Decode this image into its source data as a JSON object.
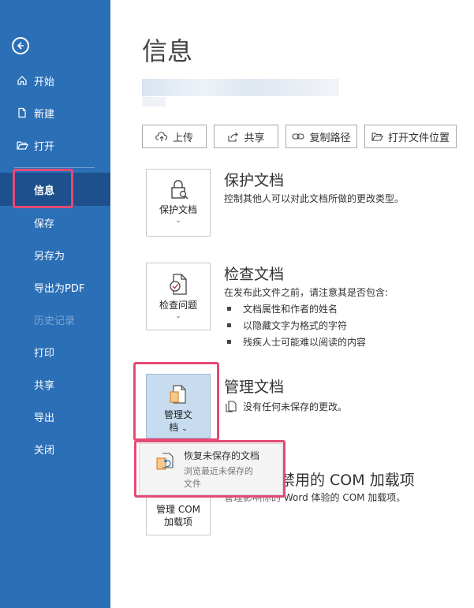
{
  "sidebar": {
    "back_icon": "arrow-left-circle-icon",
    "items": [
      {
        "label": "开始",
        "icon": "home-icon"
      },
      {
        "label": "新建",
        "icon": "new-document-icon"
      },
      {
        "label": "打开",
        "icon": "open-folder-icon"
      },
      {
        "label": "信息",
        "selected": true
      },
      {
        "label": "保存"
      },
      {
        "label": "另存为"
      },
      {
        "label": "导出为PDF"
      },
      {
        "label": "历史记录",
        "disabled": true
      },
      {
        "label": "打印"
      },
      {
        "label": "共享"
      },
      {
        "label": "导出"
      },
      {
        "label": "关闭"
      }
    ]
  },
  "main": {
    "title": "信息",
    "toolbar": [
      {
        "label": "上传",
        "icon": "cloud-upload-icon"
      },
      {
        "label": "共享",
        "icon": "share-icon"
      },
      {
        "label": "复制路径",
        "icon": "link-icon"
      },
      {
        "label": "打开文件位置",
        "icon": "folder-icon"
      }
    ],
    "sections": {
      "protect": {
        "button": "保护文档",
        "title": "保护文档",
        "desc": "控制其他人可以对此文档所做的更改类型。"
      },
      "inspect": {
        "button": "检查问题",
        "title": "检查文档",
        "desc": "在发布此文件之前，请注意其是否包含:",
        "bullets": [
          "文档属性和作者的姓名",
          "以隐藏文字为格式的字符",
          "残疾人士可能难以阅读的内容"
        ]
      },
      "manage": {
        "button_line1": "管理文",
        "button_line2": "档",
        "title": "管理文档",
        "desc": "没有任何未保存的更改。"
      },
      "com": {
        "button_line1": "管理 COM",
        "button_line2": "加载项",
        "title_fragment": "已禁用的 COM 加载项",
        "desc_prefix": "管理影响你的",
        "desc_suffix": "Word 体验的 COM 加载项。"
      }
    },
    "dropdown": {
      "title": "恢复未保存的文档",
      "desc_line1": "浏览最近未保存的",
      "desc_line2": "文件"
    }
  },
  "colors": {
    "sidebar": "#2b6fb6",
    "sidebar_selected": "#1d508d",
    "highlight": "#e44a75",
    "manage_active": "#c7dcef"
  }
}
